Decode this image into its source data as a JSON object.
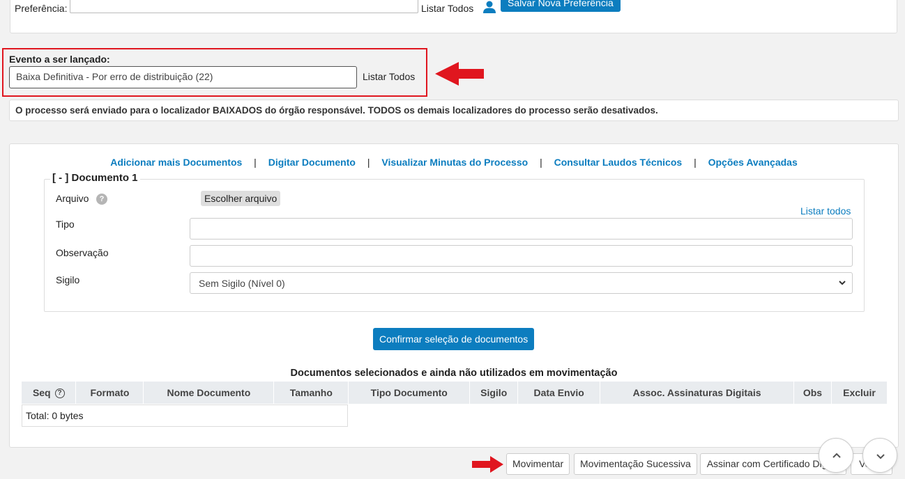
{
  "top": {
    "preferencia_label": "Preferência:",
    "listar_todos": "Listar Todos",
    "save_button": "Salvar Nova Preferência"
  },
  "evento": {
    "label": "Evento a ser lançado:",
    "value": "Baixa Definitiva - Por erro de distribuição (22)",
    "listar_todos": "Listar Todos"
  },
  "info": {
    "message": "O processo será enviado para o localizador BAIXADOS do órgão responsável. TODOS os demais localizadores do processo serão desativados."
  },
  "links": {
    "adicionar": "Adicionar mais Documentos",
    "digitar": "Digitar Documento",
    "minutas": "Visualizar Minutas do Processo",
    "laudos": "Consultar Laudos Técnicos",
    "opcoes": "Opções Avançadas",
    "separator": "|"
  },
  "documento": {
    "legend": "[ - ] Documento 1",
    "arquivo_label": "Arquivo",
    "help_glyph": "?",
    "file_button": "Escolher arquivo",
    "listar_todos": "Listar todos",
    "tipo_label": "Tipo",
    "tipo_value": "",
    "observacao_label": "Observação",
    "observacao_value": "",
    "sigilo_label": "Sigilo",
    "sigilo_value": "Sem Sigilo (Nível 0)"
  },
  "confirm_button": "Confirmar seleção de documentos",
  "table": {
    "title": "Documentos selecionados e ainda não utilizados em movimentação",
    "headers": {
      "seq": "Seq",
      "formato": "Formato",
      "nome": "Nome Documento",
      "tamanho": "Tamanho",
      "tipo": "Tipo Documento",
      "sigilo": "Sigilo",
      "data": "Data Envio",
      "assoc": "Assoc. Assinaturas Digitais",
      "obs": "Obs",
      "excluir": "Excluir"
    },
    "total": "Total: 0 bytes"
  },
  "bottom": {
    "movimentar": "Movimentar",
    "sucessiva": "Movimentação Sucessiva",
    "assinar": "Assinar com Certificado Digital",
    "voltar": "Voltar"
  },
  "colors": {
    "primary": "#0c7dbf",
    "highlight_red": "#e0161f"
  },
  "icons": [
    "user-icon",
    "help-icon",
    "chevron-down-icon",
    "chevron-up-icon",
    "red-arrow-icon"
  ]
}
